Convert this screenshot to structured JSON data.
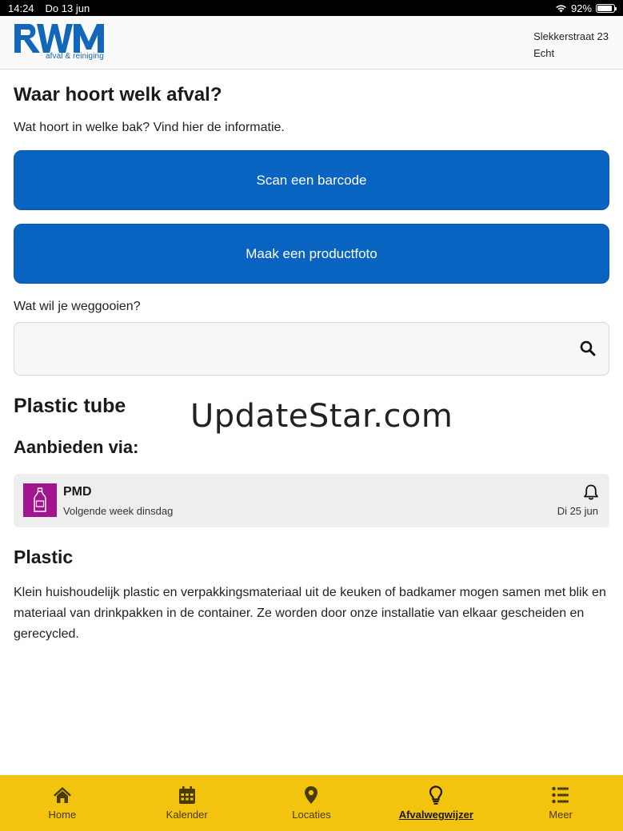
{
  "statusbar": {
    "time": "14:24",
    "date": "Do 13 jun",
    "battery": "92%",
    "battery_level": 0.92
  },
  "header": {
    "logo_text": "RWM",
    "logo_subtitle": "afval & reiniging",
    "address_street": "Slekkerstraat 23",
    "address_city": "Echt"
  },
  "page": {
    "title": "Waar hoort welk afval?",
    "intro": "Wat hoort in welke bak? Vind hier de informatie.",
    "scan_button": "Scan een barcode",
    "photo_button": "Maak een productfoto",
    "search_label": "Wat wil je weggooien?",
    "search_value": "",
    "search_icon": "search-icon"
  },
  "result": {
    "product": "Plastic tube",
    "offer_heading": "Aanbieden via:",
    "card": {
      "name": "PMD",
      "subtitle": "Volgende week dinsdag",
      "date": "Di 25 jun",
      "badge_color": "#a3148f",
      "badge_icon": "bottle-icon",
      "alert_icon": "bell-icon"
    },
    "section_title": "Plastic",
    "description": "Klein huishoudelijk plastic en verpakkingsmateriaal uit de keuken of badkamer mogen samen met blik en materiaal van drinkpakken in de container. Ze worden door onze installatie van elkaar gescheiden en gerecycled."
  },
  "watermark": "UpdateStar.com",
  "tabs": [
    {
      "label": "Home",
      "icon": "home-icon",
      "active": false
    },
    {
      "label": "Kalender",
      "icon": "calendar-icon",
      "active": false
    },
    {
      "label": "Locaties",
      "icon": "map-pin-icon",
      "active": false
    },
    {
      "label": "Afvalwegwijzer",
      "icon": "lightbulb-icon",
      "active": true
    },
    {
      "label": "Meer",
      "icon": "menu-icon",
      "active": false
    }
  ],
  "colors": {
    "primary_blue": "#0963c1",
    "tabbar_yellow": "#f2c40f",
    "pmd_purple": "#a3148f"
  }
}
